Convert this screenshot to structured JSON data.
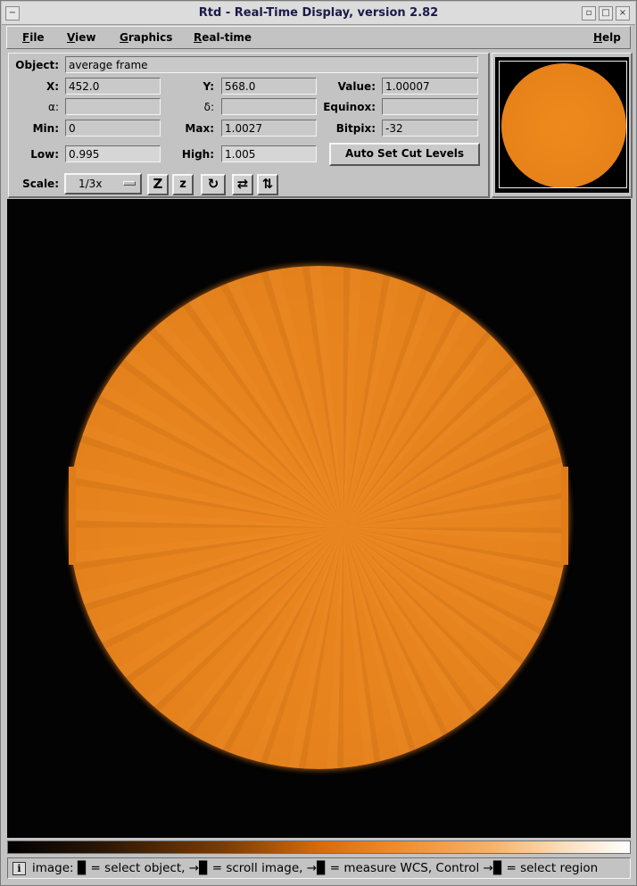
{
  "window": {
    "title": "Rtd - Real-Time Display, version 2.82",
    "controls": {
      "menu": "−",
      "minimize": "▫",
      "maximize": "□",
      "close": "×"
    }
  },
  "menubar": {
    "items": [
      {
        "label": "File",
        "mnemonic": "F",
        "rest": "ile"
      },
      {
        "label": "View",
        "mnemonic": "V",
        "rest": "iew"
      },
      {
        "label": "Graphics",
        "mnemonic": "G",
        "rest": "raphics"
      },
      {
        "label": "Real-time",
        "mnemonic": "R",
        "rest": "eal-time"
      },
      {
        "label": "Help",
        "mnemonic": "H",
        "rest": "elp"
      }
    ]
  },
  "info": {
    "object_label": "Object:",
    "object_value": "average frame",
    "x_label": "X:",
    "x_value": "452.0",
    "y_label": "Y:",
    "y_value": "568.0",
    "value_label": "Value:",
    "value_value": "1.00007",
    "alpha_label": "α:",
    "alpha_value": "",
    "delta_label": "δ:",
    "delta_value": "",
    "equinox_label": "Equinox:",
    "equinox_value": "",
    "min_label": "Min:",
    "min_value": "0",
    "max_label": "Max:",
    "max_value": "1.0027",
    "bitpix_label": "Bitpix:",
    "bitpix_value": "-32",
    "low_label": "Low:",
    "low_value": "0.995",
    "high_label": "High:",
    "high_value": "1.005",
    "auto_cut_label": "Auto Set Cut Levels",
    "scale_label": "Scale:",
    "scale_value": "1/3x"
  },
  "toolbar": {
    "zoom_in": "Z",
    "zoom_out": "z",
    "rotate": "↻",
    "flip_x": "⇄",
    "flip_y": "⇅"
  },
  "status": {
    "text": "image: ▉ = select object, →▉ = scroll image, →▉ = measure WCS, Control →▉ = select region",
    "icon": "i"
  },
  "colors": {
    "image_orange": "#e7831d",
    "panel_gray": "#c3c3c3",
    "background_black": "#030303"
  },
  "icons": {
    "info": "info-icon",
    "zoom_in": "zoom-in-icon",
    "zoom_out": "zoom-out-icon",
    "rotate": "rotate-icon",
    "flip_x": "flip-x-icon",
    "flip_y": "flip-y-icon"
  }
}
